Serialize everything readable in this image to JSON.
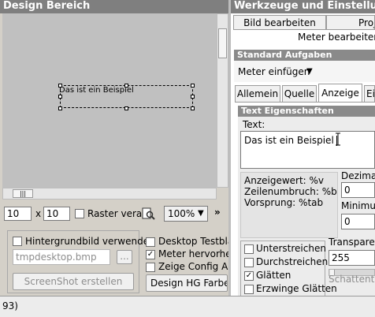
{
  "left": {
    "header": "Design Bereich",
    "canvas_label": "Das ist ein Beispiel",
    "scroll_grip": "|||",
    "toolbar": {
      "grid_x": "10",
      "x_sep": "x",
      "grid_y": "10",
      "raster_label": "Raster vera",
      "zoom_value": "100%",
      "zoom_arrow": "▼",
      "more_arrow": "»"
    },
    "options": {
      "bg_image_label": "Hintergrundbild verwende",
      "bg_image_file": "tmpdesktop.bmp",
      "browse_label": "...",
      "screenshot_label": "ScreenShot erstellen",
      "desktop_test_label": "Desktop Testblatt",
      "highlight_meter_label": "Meter hervorhebe",
      "show_config_label": "Zeige Config Aus",
      "design_bg_label": "Design HG Farbe..."
    }
  },
  "right": {
    "header": "Werkzeuge und Einstellunge",
    "top_tabs": [
      "Bild bearbeiten",
      "Projekt"
    ],
    "subtitle": "Meter bearbeiten",
    "standard_section": "Standard Aufgaben",
    "insert_meter_label": "Meter einfügen",
    "insert_meter_arrow": "▼",
    "tabs": [
      "Allemein",
      "Quelle",
      "Anzeige",
      "Ei"
    ],
    "active_tab": "Anzeige",
    "text_section": "Text Eigenschaften",
    "text_label": "Text:",
    "text_value": "Das ist ein Beispiel",
    "help_lines": [
      "Anzeigewert: %v",
      "Zeilenumbruch: %b",
      "Vorsprung: %tab"
    ],
    "decimal_label": "Dezimal",
    "decimal_value": "0",
    "minimum_label": "Minimu",
    "minimum_value": "0",
    "transparency_label": "Transparen",
    "transparency_value": "255",
    "shadow_label": "Schattentra",
    "checkboxes": [
      {
        "label": "Unterstreichen",
        "checked": false
      },
      {
        "label": "Durchstreichen",
        "checked": false
      },
      {
        "label": "Glätten",
        "checked": true
      },
      {
        "label": "Erzwinge Glätten",
        "checked": false
      }
    ]
  },
  "status": {
    "text": "93)"
  }
}
